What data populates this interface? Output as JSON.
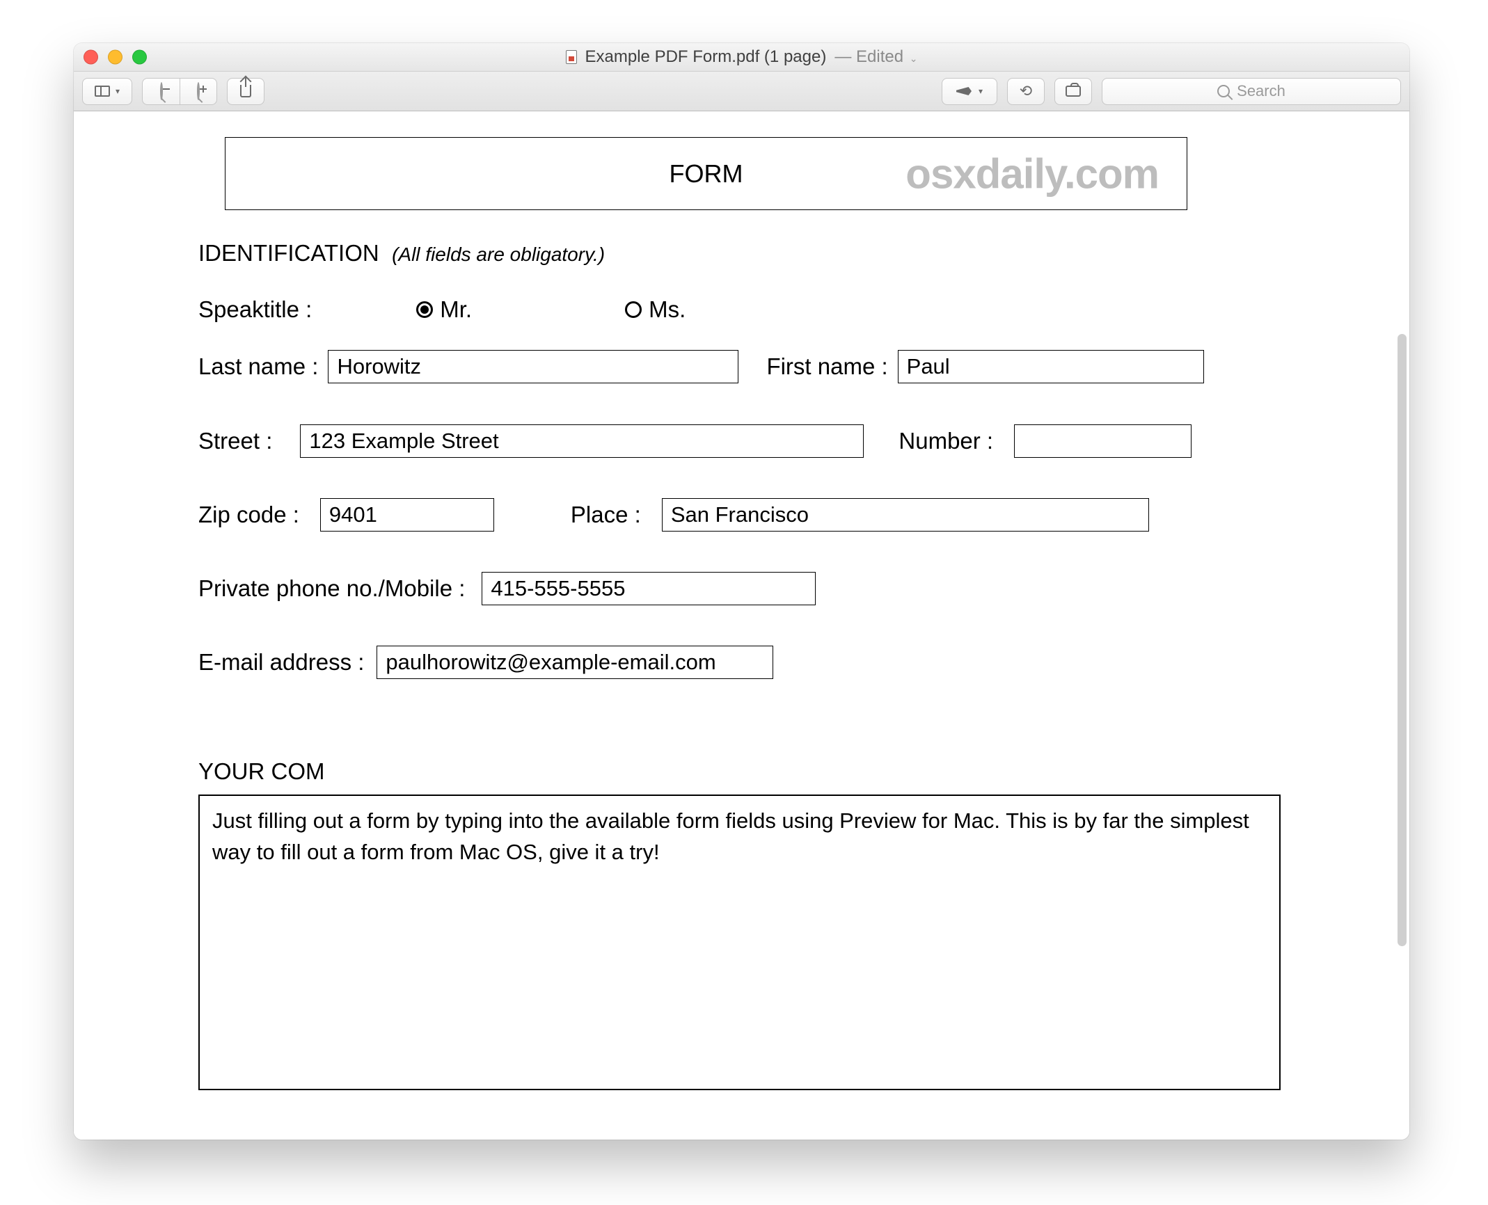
{
  "window": {
    "title": "Example PDF Form.pdf (1 page)",
    "edited_label": "Edited"
  },
  "toolbar": {
    "search_placeholder": "Search"
  },
  "watermark": "osxdaily.com",
  "form": {
    "title": "FORM",
    "section_heading": "IDENTIFICATION",
    "section_hint": "(All fields are obligatory.)",
    "speaktitle_label": "Speaktitle :",
    "mr_label": "Mr.",
    "ms_label": "Ms.",
    "speaktitle_selected": "mr",
    "last_name_label": "Last name :",
    "last_name_value": "Horowitz",
    "first_name_label": "First name :",
    "first_name_value": "Paul",
    "street_label": "Street :",
    "street_value": "123 Example Street",
    "number_label": "Number :",
    "number_value": "",
    "zip_label": "Zip code :",
    "zip_value": "9401",
    "place_label": "Place :",
    "place_value": "San Francisco",
    "phone_label": "Private phone no./Mobile  :",
    "phone_value": "415-555-5555",
    "email_label": "E-mail address :",
    "email_value": "paulhorowitz@example-email.com",
    "comments_heading": "YOUR COM",
    "comments_value": "Just filling out a form by typing into the available form fields using Preview for Mac. This is by far the simplest way to fill out a form from Mac OS, give it a try!"
  }
}
